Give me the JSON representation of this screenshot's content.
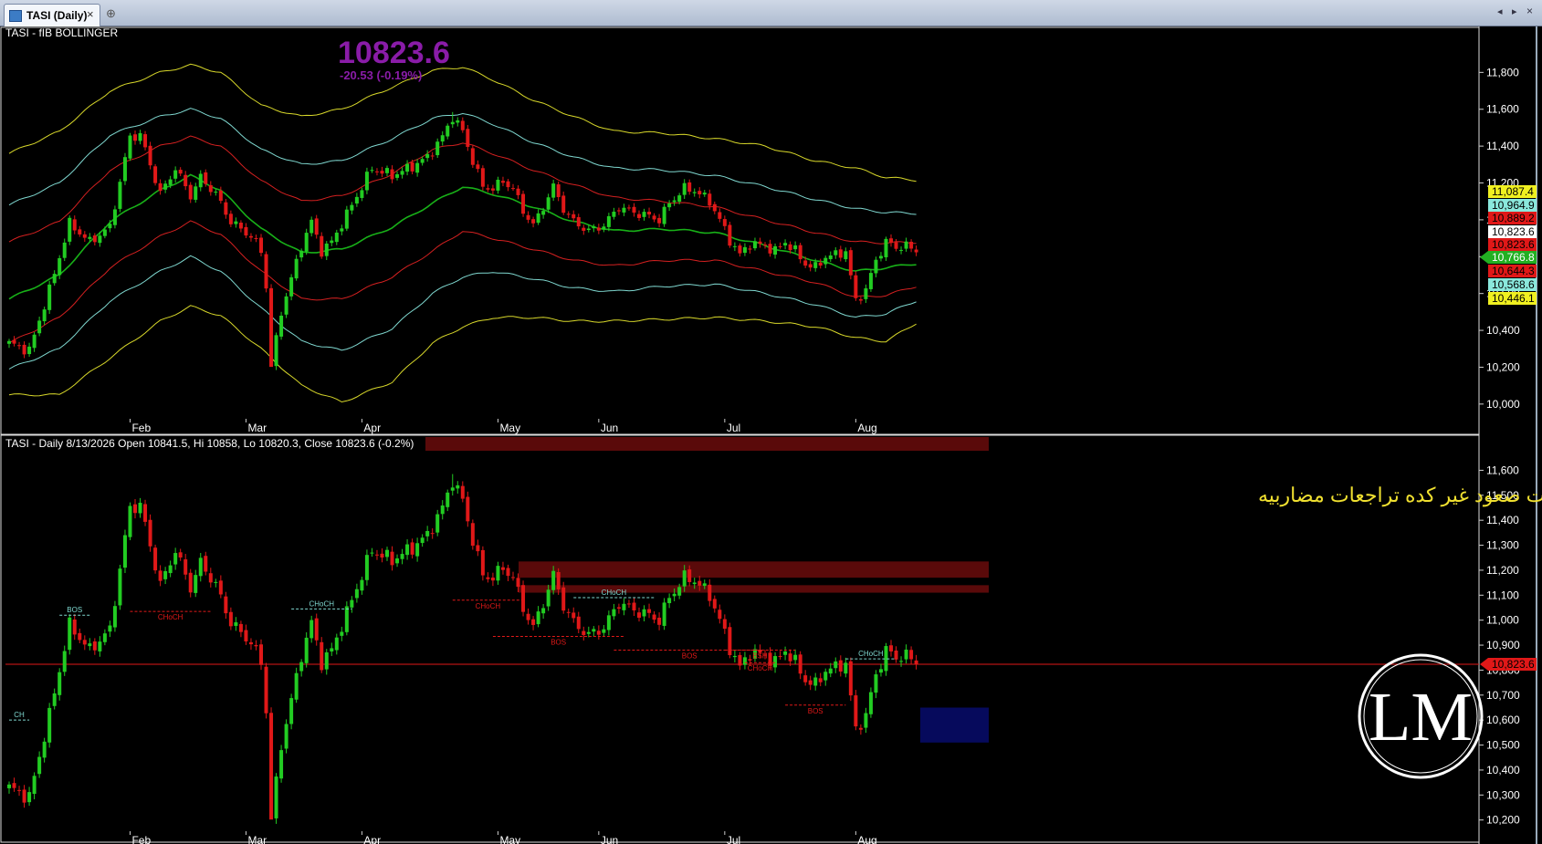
{
  "window": {
    "tab_title": "TASI (Daily)",
    "close_glyph": "×",
    "new_tab_glyph": "⊕",
    "nav_left_glyph": "◂",
    "nav_right_glyph": "▸",
    "nav_close_glyph": "×",
    "icons": [
      "chart-tab-icon",
      "close-icon",
      "new-tab-icon",
      "scroll-left-icon",
      "scroll-right-icon",
      "close-window-icon"
    ]
  },
  "colors": {
    "up": "#22cc22",
    "down": "#e01818",
    "outer_band": "#d8d82a",
    "cyan_band": "#7fd8d0",
    "red_band": "#d42020",
    "mid_band": "#18b018",
    "title_price": "#8a1ca8",
    "annotation": "#f0e030",
    "supply_zone": "#5a0a0a",
    "demand_zone": "#060a5c"
  },
  "top_panel": {
    "title": "TASI - fIB BOLLINGER",
    "big_price": "10823.6",
    "change": "-20.53 (-0.19%)",
    "band_tags": [
      {
        "label": "11,087.4",
        "value": 11087.4,
        "bg": "#f0f020",
        "fg": "#000"
      },
      {
        "label": "10,964.9",
        "value": 10964.9,
        "bg": "#8ae8dc",
        "fg": "#000"
      },
      {
        "label": "10,889.2",
        "value": 10889.2,
        "bg": "#e01818",
        "fg": "#000"
      },
      {
        "label": "10,823.6",
        "value": 10823.6,
        "bg": "#ffffff",
        "fg": "#000"
      },
      {
        "label": "10,823.6",
        "value": 10823.6,
        "bg": "#e01818",
        "fg": "#000"
      },
      {
        "label": "10,766.8",
        "value": 10766.8,
        "bg": "#22b022",
        "fg": "#fff"
      },
      {
        "label": "10,644.3",
        "value": 10644.3,
        "bg": "#e01818",
        "fg": "#000"
      },
      {
        "label": "10,568.6",
        "value": 10568.6,
        "bg": "#8ae8dc",
        "fg": "#000"
      },
      {
        "label": "10,446.1",
        "value": 10446.1,
        "bg": "#f0f020",
        "fg": "#000"
      }
    ]
  },
  "bottom_panel": {
    "title": "TASI - Daily 8/13/2026 Open 10841.5, Hi 10858, Lo 10820.3, Close 10823.6 (-0.2%)",
    "annotation": "العوده فوق الخط الاحمر والثبات صعود غير كده تراجعات مضاربيه",
    "price_tag": "10,823.6",
    "structure_labels": [
      "CH",
      "BOS",
      "CHoCH",
      "CHoCH",
      "CHoCH",
      "BOS",
      "CHoCH",
      "BOS",
      "BSH",
      "CHoCH",
      "BOS",
      "CHoCH"
    ]
  },
  "logo": {
    "text": "LM"
  },
  "chart_data": {
    "type": "candlestick",
    "title": "TASI - fIB BOLLINGER",
    "x_months": [
      "Feb",
      "Mar",
      "Apr",
      "May",
      "Jun",
      "Jul",
      "Aug"
    ],
    "top_y_ticks": [
      "11,800",
      "11,600",
      "11,400",
      "11,200",
      "11,000",
      "10,800",
      "10,600",
      "10,400",
      "10,200",
      "10,000"
    ],
    "top_ylim": [
      9920,
      11980
    ],
    "bottom_y_ticks": [
      "11,600",
      "11,500",
      "11,400",
      "11,300",
      "11,200",
      "11,100",
      "11,000",
      "10,900",
      "10,800",
      "10,700",
      "10,600",
      "10,500",
      "10,400",
      "10,300",
      "10,200"
    ],
    "bottom_ylim": [
      10155,
      11660
    ],
    "close_series_anchors": [
      [
        0,
        10330
      ],
      [
        4,
        10290
      ],
      [
        8,
        10620
      ],
      [
        12,
        10980
      ],
      [
        16,
        10880
      ],
      [
        20,
        10960
      ],
      [
        24,
        11450
      ],
      [
        26,
        11460
      ],
      [
        30,
        11140
      ],
      [
        33,
        11280
      ],
      [
        36,
        11130
      ],
      [
        38,
        11230
      ],
      [
        41,
        11140
      ],
      [
        44,
        10990
      ],
      [
        48,
        10910
      ],
      [
        50,
        10830
      ],
      [
        51,
        10640
      ],
      [
        52,
        10200
      ],
      [
        54,
        10500
      ],
      [
        56,
        10680
      ],
      [
        58,
        10860
      ],
      [
        60,
        10990
      ],
      [
        62,
        10830
      ],
      [
        64,
        10880
      ],
      [
        68,
        11080
      ],
      [
        72,
        11280
      ],
      [
        76,
        11240
      ],
      [
        80,
        11290
      ],
      [
        83,
        11340
      ],
      [
        86,
        11450
      ],
      [
        88,
        11560
      ],
      [
        90,
        11480
      ],
      [
        92,
        11320
      ],
      [
        94,
        11180
      ],
      [
        96,
        11170
      ],
      [
        98,
        11210
      ],
      [
        100,
        11170
      ],
      [
        102,
        11050
      ],
      [
        104,
        10970
      ],
      [
        106,
        11070
      ],
      [
        108,
        11180
      ],
      [
        110,
        11060
      ],
      [
        112,
        10990
      ],
      [
        115,
        10940
      ],
      [
        118,
        10970
      ],
      [
        121,
        11070
      ],
      [
        124,
        11040
      ],
      [
        127,
        11020
      ],
      [
        129,
        11000
      ],
      [
        131,
        11090
      ],
      [
        134,
        11170
      ],
      [
        136,
        11160
      ],
      [
        139,
        11100
      ],
      [
        141,
        11000
      ],
      [
        143,
        10890
      ],
      [
        145,
        10810
      ],
      [
        147,
        10870
      ],
      [
        150,
        10860
      ],
      [
        152,
        10830
      ],
      [
        154,
        10880
      ],
      [
        156,
        10830
      ],
      [
        158,
        10760
      ],
      [
        160,
        10740
      ],
      [
        162,
        10800
      ],
      [
        164,
        10810
      ],
      [
        166,
        10830
      ],
      [
        167,
        10690
      ],
      [
        168,
        10560
      ],
      [
        170,
        10620
      ],
      [
        172,
        10780
      ],
      [
        174,
        10880
      ],
      [
        176,
        10850
      ],
      [
        178,
        10860
      ],
      [
        180,
        10820
      ]
    ],
    "bollinger_bands": [
      {
        "name": "upper 3",
        "anchors": [
          [
            0,
            11360
          ],
          [
            10,
            11480
          ],
          [
            20,
            11700
          ],
          [
            30,
            11800
          ],
          [
            36,
            11840
          ],
          [
            42,
            11800
          ],
          [
            50,
            11620
          ],
          [
            58,
            11560
          ],
          [
            66,
            11600
          ],
          [
            76,
            11720
          ],
          [
            84,
            11810
          ],
          [
            90,
            11830
          ],
          [
            96,
            11760
          ],
          [
            104,
            11650
          ],
          [
            112,
            11560
          ],
          [
            120,
            11480
          ],
          [
            130,
            11470
          ],
          [
            140,
            11440
          ],
          [
            150,
            11400
          ],
          [
            160,
            11320
          ],
          [
            168,
            11280
          ],
          [
            174,
            11230
          ],
          [
            180,
            11215
          ]
        ]
      },
      {
        "name": "upper 2",
        "anchors": [
          [
            0,
            11080
          ],
          [
            10,
            11200
          ],
          [
            20,
            11460
          ],
          [
            30,
            11560
          ],
          [
            36,
            11600
          ],
          [
            42,
            11550
          ],
          [
            50,
            11380
          ],
          [
            58,
            11300
          ],
          [
            66,
            11320
          ],
          [
            76,
            11440
          ],
          [
            84,
            11550
          ],
          [
            90,
            11580
          ],
          [
            96,
            11520
          ],
          [
            104,
            11420
          ],
          [
            112,
            11340
          ],
          [
            120,
            11280
          ],
          [
            130,
            11270
          ],
          [
            140,
            11240
          ],
          [
            150,
            11180
          ],
          [
            160,
            11110
          ],
          [
            168,
            11060
          ],
          [
            174,
            11040
          ],
          [
            180,
            11035
          ]
        ]
      },
      {
        "name": "upper 1",
        "anchors": [
          [
            0,
            10880
          ],
          [
            10,
            10990
          ],
          [
            20,
            11270
          ],
          [
            30,
            11400
          ],
          [
            36,
            11450
          ],
          [
            42,
            11400
          ],
          [
            50,
            11210
          ],
          [
            58,
            11100
          ],
          [
            66,
            11130
          ],
          [
            76,
            11250
          ],
          [
            84,
            11380
          ],
          [
            90,
            11420
          ],
          [
            96,
            11360
          ],
          [
            104,
            11270
          ],
          [
            112,
            11190
          ],
          [
            120,
            11120
          ],
          [
            130,
            11100
          ],
          [
            140,
            11070
          ],
          [
            150,
            11000
          ],
          [
            160,
            10930
          ],
          [
            168,
            10880
          ],
          [
            174,
            10875
          ],
          [
            180,
            10878
          ]
        ]
      },
      {
        "name": "middle",
        "anchors": [
          [
            0,
            10570
          ],
          [
            10,
            10700
          ],
          [
            20,
            10990
          ],
          [
            30,
            11160
          ],
          [
            36,
            11240
          ],
          [
            42,
            11160
          ],
          [
            50,
            10950
          ],
          [
            58,
            10820
          ],
          [
            66,
            10840
          ],
          [
            76,
            10960
          ],
          [
            84,
            11090
          ],
          [
            90,
            11180
          ],
          [
            96,
            11140
          ],
          [
            104,
            11070
          ],
          [
            112,
            10990
          ],
          [
            120,
            10940
          ],
          [
            130,
            10950
          ],
          [
            140,
            10930
          ],
          [
            150,
            10860
          ],
          [
            160,
            10780
          ],
          [
            168,
            10720
          ],
          [
            174,
            10740
          ],
          [
            180,
            10762
          ]
        ]
      },
      {
        "name": "lower 1",
        "anchors": [
          [
            0,
            10330
          ],
          [
            10,
            10470
          ],
          [
            20,
            10740
          ],
          [
            30,
            10910
          ],
          [
            36,
            10990
          ],
          [
            42,
            10920
          ],
          [
            50,
            10720
          ],
          [
            58,
            10570
          ],
          [
            66,
            10570
          ],
          [
            76,
            10690
          ],
          [
            84,
            10830
          ],
          [
            90,
            10940
          ],
          [
            96,
            10900
          ],
          [
            104,
            10840
          ],
          [
            112,
            10780
          ],
          [
            120,
            10750
          ],
          [
            130,
            10780
          ],
          [
            140,
            10780
          ],
          [
            150,
            10720
          ],
          [
            160,
            10660
          ],
          [
            168,
            10580
          ],
          [
            174,
            10590
          ],
          [
            180,
            10640
          ]
        ]
      },
      {
        "name": "lower 2",
        "anchors": [
          [
            0,
            10190
          ],
          [
            10,
            10300
          ],
          [
            20,
            10560
          ],
          [
            30,
            10720
          ],
          [
            36,
            10800
          ],
          [
            42,
            10720
          ],
          [
            50,
            10520
          ],
          [
            58,
            10340
          ],
          [
            66,
            10290
          ],
          [
            76,
            10410
          ],
          [
            84,
            10600
          ],
          [
            90,
            10690
          ],
          [
            96,
            10720
          ],
          [
            104,
            10680
          ],
          [
            112,
            10630
          ],
          [
            120,
            10610
          ],
          [
            130,
            10640
          ],
          [
            140,
            10650
          ],
          [
            150,
            10600
          ],
          [
            160,
            10540
          ],
          [
            168,
            10470
          ],
          [
            174,
            10490
          ],
          [
            180,
            10560
          ]
        ]
      },
      {
        "name": "lower 3",
        "anchors": [
          [
            0,
            10050
          ],
          [
            10,
            10050
          ],
          [
            20,
            10250
          ],
          [
            30,
            10450
          ],
          [
            36,
            10530
          ],
          [
            42,
            10480
          ],
          [
            50,
            10300
          ],
          [
            58,
            10100
          ],
          [
            66,
            10010
          ],
          [
            76,
            10120
          ],
          [
            84,
            10330
          ],
          [
            90,
            10420
          ],
          [
            96,
            10470
          ],
          [
            104,
            10470
          ],
          [
            112,
            10450
          ],
          [
            120,
            10450
          ],
          [
            130,
            10460
          ],
          [
            140,
            10470
          ],
          [
            150,
            10450
          ],
          [
            160,
            10420
          ],
          [
            168,
            10360
          ],
          [
            174,
            10340
          ],
          [
            180,
            10440
          ]
        ]
      }
    ],
    "horizontal_line": 10823.6,
    "supply_zones": [
      [
        11110,
        11140
      ],
      [
        11170,
        11235
      ]
    ],
    "demand_zone": [
      10510,
      10650
    ]
  }
}
